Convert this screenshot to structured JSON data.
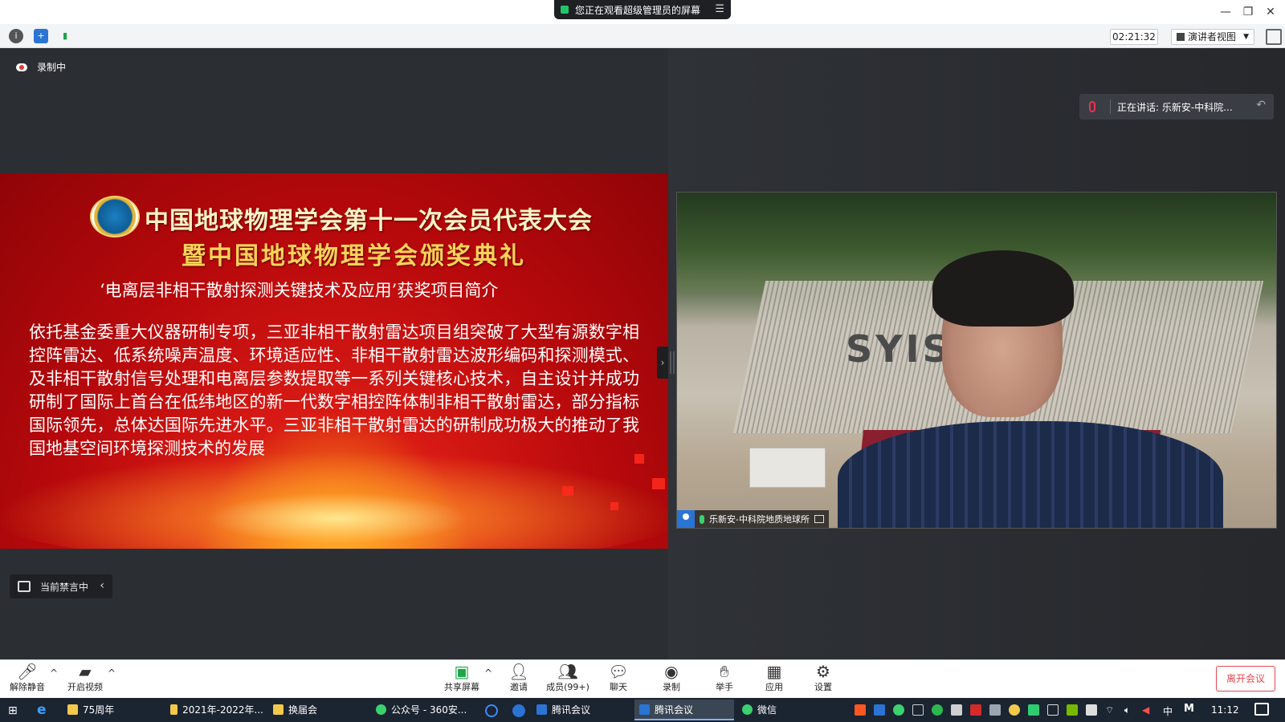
{
  "titlebar": {
    "sharing_banner": "您正在观看超级管理员的屏幕",
    "controls": [
      "minimize-icon",
      "restore-icon",
      "close-icon"
    ]
  },
  "infobar": {
    "icons": [
      "info-icon",
      "shield-icon",
      "signal-icon"
    ],
    "timer": "02:21:32",
    "view_mode": "演讲者视图"
  },
  "recording_label": "录制中",
  "slide": {
    "title1": "中国地球物理学会第十一次会员代表大会",
    "title2": "暨中国地球物理学会颁奖典礼",
    "subtitle": "‘电离层非相干散射探测关键技术及应用’获奖项目简介",
    "body": "依托基金委重大仪器研制专项，三亚非相干散射雷达项目组突破了大型有源数字相控阵雷达、低系统噪声温度、环境适应性、非相干散射雷达波形编码和探测模式、及非相干散射信号处理和电离层参数提取等一系列关键核心技术，自主设计并成功研制了国际上首台在低纬地区的新一代数字相控阵体制非相干散射雷达，部分指标国际领先，总体达国际先进水平。三亚非相干散射雷达的研制成功极大的推动了我国地基空间环境探测技术的发展",
    "video_backdrop_text": "SYIS"
  },
  "mute_status": "当前禁言中",
  "speaking": "正在讲话: 乐新安-中科院...",
  "video_label": "乐新安-中科院地质地球所",
  "toolbar": {
    "unmute": "解除静音",
    "start_video": "开启视频",
    "share_screen": "共享屏幕",
    "invite": "邀请",
    "members": "成员(99+)",
    "chat": "聊天",
    "record": "录制",
    "raise_hand": "举手",
    "apps": "应用",
    "settings": "设置",
    "leave": "离开会议"
  },
  "taskbar": {
    "tasks": [
      "75周年",
      "2021年-2022年...",
      "换届会",
      "公众号 - 360安...",
      "腾讯会议",
      "腾讯会议",
      "微信"
    ],
    "ime": "中",
    "time": "11:12"
  },
  "colors": {
    "accent_blue": "#2a74d4",
    "leave_red": "#e5484d",
    "slide_red": "#b8090c"
  }
}
